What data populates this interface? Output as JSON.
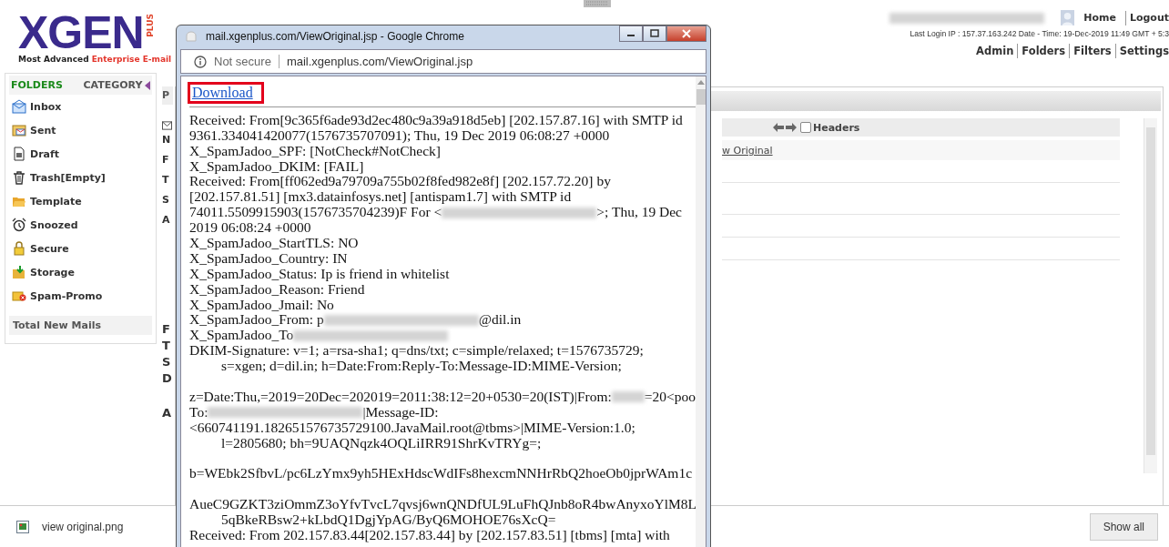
{
  "app": {
    "logo": {
      "brand": "XGEN",
      "badge": "PLUS",
      "tagline_dark": "Most Advanced",
      "tagline_red": "Enterprise E-mail"
    },
    "header": {
      "user_links": [
        "Home",
        "Logout"
      ],
      "last_login": "Last Login IP : 157.37.163.242 Date - Time: 19-Dec-2019 11:49 GMT + 5:3",
      "nav_links": [
        "Admin",
        "Folders",
        "Filters",
        "Settings"
      ]
    },
    "sidebar": {
      "tabs": [
        {
          "label": "FOLDERS",
          "selected": true
        },
        {
          "label": "CATEGORY",
          "selected": false
        }
      ],
      "items": [
        {
          "label": "Inbox",
          "kind": "inbox"
        },
        {
          "label": "Sent",
          "kind": "sent"
        },
        {
          "label": "Draft",
          "kind": "draft"
        },
        {
          "label": "Trash[Empty]",
          "kind": "trash"
        },
        {
          "label": "Template",
          "kind": "template"
        },
        {
          "label": "Snoozed",
          "kind": "snoozed"
        },
        {
          "label": "Secure",
          "kind": "secure"
        },
        {
          "label": "Storage",
          "kind": "storage"
        },
        {
          "label": "Spam-Promo",
          "kind": "spam"
        }
      ],
      "footer": "Total New Mails"
    },
    "main": {
      "tab_letter": "P",
      "peek_top": [
        "N",
        "F",
        "T",
        "S",
        "A"
      ],
      "peek_bottom": [
        "F",
        "T",
        "S",
        "D",
        "A"
      ],
      "headers_checkbox": {
        "label": "Headers",
        "checked": false
      },
      "original_link": "w Original"
    }
  },
  "popup": {
    "title": "mail.xgenplus.com/ViewOriginal.jsp - Google Chrome",
    "security": "Not secure",
    "url": "mail.xgenplus.com/ViewOriginal.jsp",
    "download": "Download",
    "lines": [
      {
        "kind": "text",
        "indent": false,
        "parts": [
          "Received: From[9c365f6ade93d2ec480c9a39a918d5eb] [202.157.87.16] with SMTP id"
        ]
      },
      {
        "kind": "text",
        "indent": false,
        "parts": [
          "9361.334041420077(1576735707091); Thu, 19 Dec 2019 06:08:27 +0000"
        ]
      },
      {
        "kind": "text",
        "indent": false,
        "parts": [
          "X_SpamJadoo_SPF: [NotCheck#NotCheck]"
        ]
      },
      {
        "kind": "text",
        "indent": false,
        "parts": [
          "X_SpamJadoo_DKIM: [FAIL]"
        ]
      },
      {
        "kind": "text",
        "indent": false,
        "parts": [
          "Received: From[ff062ed9a79709a755b02f8fed982e8f] [202.157.72.20] by"
        ]
      },
      {
        "kind": "text",
        "indent": false,
        "parts": [
          "[202.157.81.51] [mx3.datainfosys.net] [antispam1.7] with SMTP id"
        ]
      },
      {
        "kind": "text",
        "indent": false,
        "parts": [
          "74011.5509915903(1576735704239)F For <",
          {
            "kind": "blur"
          },
          ">; Thu, 19 Dec"
        ]
      },
      {
        "kind": "text",
        "indent": false,
        "parts": [
          "2019 06:08:24 +0000"
        ]
      },
      {
        "kind": "text",
        "indent": false,
        "parts": [
          "X_SpamJadoo_StartTLS: NO"
        ]
      },
      {
        "kind": "text",
        "indent": false,
        "parts": [
          "X_SpamJadoo_Country: IN"
        ]
      },
      {
        "kind": "text",
        "indent": false,
        "parts": [
          "X_SpamJadoo_Status: Ip is friend in whitelist"
        ]
      },
      {
        "kind": "text",
        "indent": false,
        "parts": [
          "X_SpamJadoo_Reason: Friend"
        ]
      },
      {
        "kind": "text",
        "indent": false,
        "parts": [
          "X_SpamJadoo_Jmail: No"
        ]
      },
      {
        "kind": "text",
        "indent": false,
        "parts": [
          "X_SpamJadoo_From: p",
          {
            "kind": "blur"
          },
          "@dil.in"
        ]
      },
      {
        "kind": "text",
        "indent": false,
        "parts": [
          "X_SpamJadoo_To",
          {
            "kind": "blur"
          }
        ]
      },
      {
        "kind": "text",
        "indent": false,
        "parts": [
          "DKIM-Signature: v=1; a=rsa-sha1; q=dns/txt; c=simple/relaxed; t=1576735729;"
        ]
      },
      {
        "kind": "text",
        "indent": true,
        "parts": [
          "s=xgen; d=dil.in; h=Date:From:Reply-To:Message-ID:MIME-Version;"
        ]
      },
      {
        "kind": "blank"
      },
      {
        "kind": "text",
        "indent": false,
        "parts": [
          "z=Date:Thu,=2019=20Dec=202019=2011:38:12=20+0530=20(IST)|From:",
          {
            "kind": "blur"
          },
          "=20<poo"
        ]
      },
      {
        "kind": "text",
        "indent": false,
        "parts": [
          "To:",
          {
            "kind": "blur"
          },
          "|Message-ID:"
        ]
      },
      {
        "kind": "text",
        "indent": false,
        "parts": [
          "<660741191.182651576735729100.JavaMail.root@tbms>|MIME-Version:1.0;"
        ]
      },
      {
        "kind": "text",
        "indent": true,
        "parts": [
          "l=2805680; bh=9UAQNqzk4OQLiIRR91ShrKvTRYg=;"
        ]
      },
      {
        "kind": "blank"
      },
      {
        "kind": "text",
        "indent": false,
        "parts": [
          "b=WEbk2SfbvL/pc6LzYmx9yh5HExHdscWdIFs8hexcmNNHrRbQ2hoeOb0jprWAm1c"
        ]
      },
      {
        "kind": "blank"
      },
      {
        "kind": "text",
        "indent": false,
        "parts": [
          "AueC9GZKT3ziOmmZ3oYfvTvcL7qvsj6wnQNDfUL9LuFhQJnb8oR4bwAnyxoYlM8L"
        ]
      },
      {
        "kind": "text",
        "indent": true,
        "parts": [
          "5qBkeRBsw2+kLbdQ1DgjYpAG/ByQ6MOHOE76sXcQ="
        ]
      },
      {
        "kind": "text",
        "indent": false,
        "parts": [
          "Received: From 202.157.83.44[202.157.83.44] by [202.157.83.51] [tbms] [mta] with"
        ]
      }
    ]
  },
  "download_bar": {
    "file": "view original.png",
    "button": "Show all"
  }
}
